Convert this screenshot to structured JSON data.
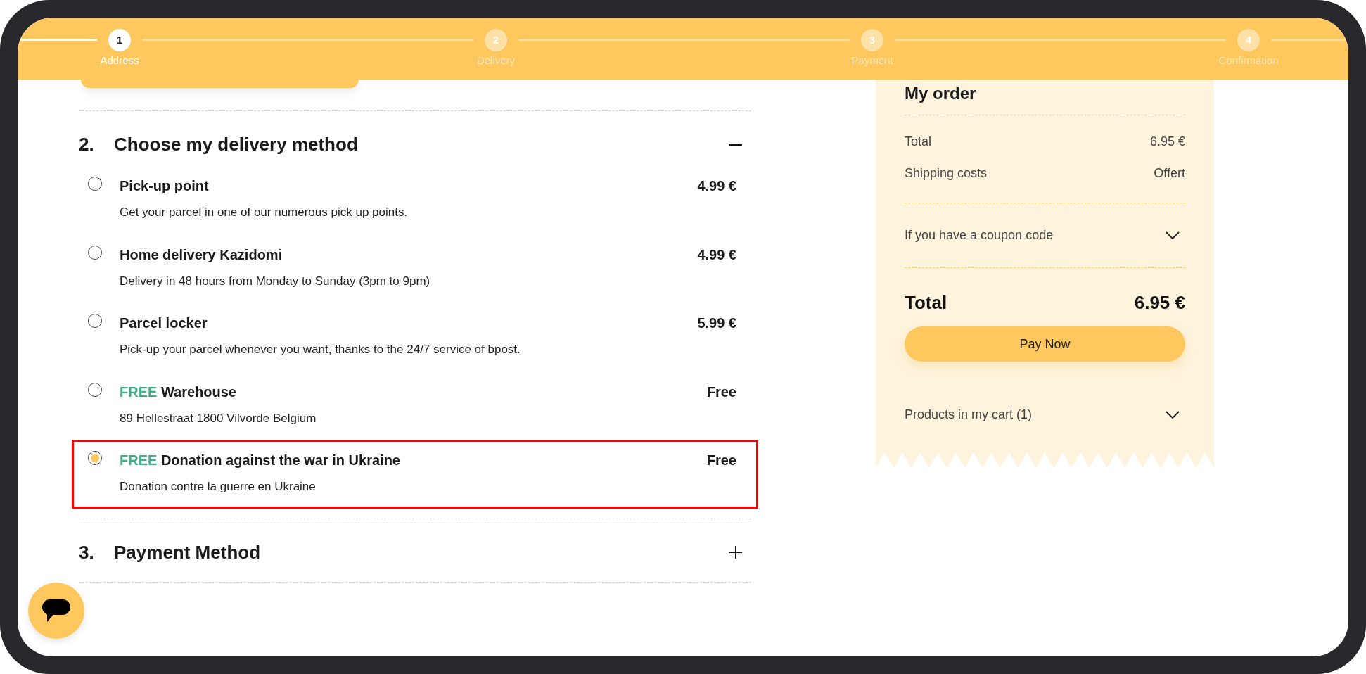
{
  "steps": [
    {
      "number": "1",
      "label": "Address",
      "active": true
    },
    {
      "number": "2",
      "label": "Delivery",
      "active": false
    },
    {
      "number": "3",
      "label": "Payment",
      "active": false
    },
    {
      "number": "4",
      "label": "Confirmation",
      "active": false
    }
  ],
  "sections": [
    {
      "number": "2.",
      "title": "Choose my delivery method",
      "expanded": true,
      "options": [
        {
          "title": "Pick-up point",
          "description": "Get your parcel in one of our numerous pick up points.",
          "price": "4.99 €",
          "selected": false,
          "highlighted": false
        },
        {
          "title": "Home delivery Kazidomi",
          "description": "Delivery in 48 hours from Monday to Sunday (3pm to 9pm)",
          "price": "4.99 €",
          "selected": false,
          "highlighted": false
        },
        {
          "title": "Parcel locker",
          "description": "Pick-up your parcel whenever you want, thanks to the 24/7 service of bpost.",
          "price": "5.99 €",
          "selected": false,
          "highlighted": false
        },
        {
          "tag": "FREE",
          "title": "Warehouse",
          "description": "89 Hellestraat 1800 Vilvorde Belgium",
          "price": "Free",
          "selected": false,
          "highlighted": false
        },
        {
          "tag": "FREE",
          "title": "Donation against the war in Ukraine",
          "description": "Donation contre la guerre en Ukraine",
          "price": "Free",
          "selected": true,
          "highlighted": true
        }
      ]
    },
    {
      "number": "3.",
      "title": "Payment Method",
      "expanded": false
    }
  ],
  "order": {
    "title": "My order",
    "lines": [
      {
        "label": "Total",
        "value": "6.95 €"
      },
      {
        "label": "Shipping costs",
        "value": "Offert"
      }
    ],
    "coupon": {
      "label": "If you have a coupon code",
      "expanded": false
    },
    "total": {
      "label": "Total",
      "value": "6.95 €"
    },
    "pay_button": "Pay Now",
    "cart": {
      "label": "Products in my cart (1)",
      "expanded": false
    }
  }
}
